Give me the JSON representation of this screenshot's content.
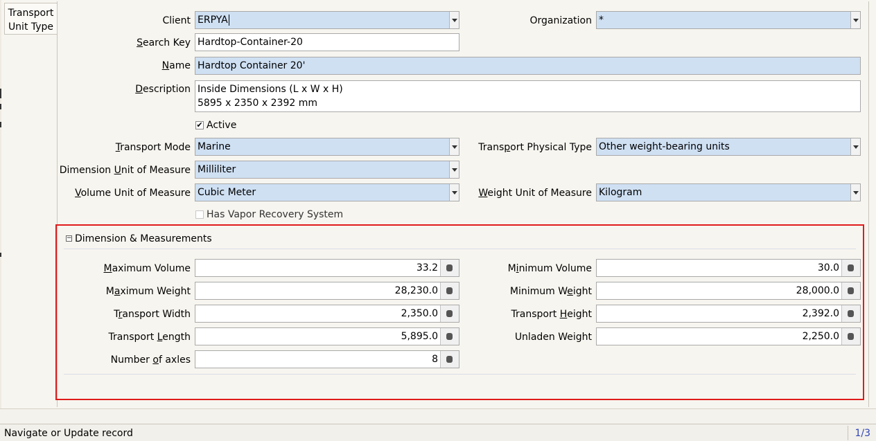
{
  "tab": {
    "label_line1": "Transport",
    "label_line2": "Unit Type"
  },
  "form": {
    "client": {
      "label_pre": "Client",
      "value": "ERPYA"
    },
    "organization": {
      "label": "Organization",
      "value": "*"
    },
    "search_key": {
      "label_u": "S",
      "label_rest": "earch Key",
      "value": "Hardtop-Container-20"
    },
    "name": {
      "label_u": "N",
      "label_rest": "ame",
      "value": "Hardtop Container 20'"
    },
    "description": {
      "label_u": "D",
      "label_rest": "escription",
      "line1": "Inside Dimensions (L x W x H)",
      "line2": "5895 x 2350 x 2392 mm"
    },
    "active": {
      "label": "Active",
      "checked": true,
      "mark": "✔"
    },
    "transport_mode": {
      "label_u": "T",
      "label_rest": "ransport Mode",
      "value": "Marine"
    },
    "transport_physical_type": {
      "label_pre": "Trans",
      "label_u": "p",
      "label_rest": "ort Physical Type",
      "value": "Other weight-bearing units"
    },
    "dimension_uom": {
      "label_pre": "Dimension ",
      "label_u": "U",
      "label_rest": "nit of Measure",
      "value": "Milliliter"
    },
    "volume_uom": {
      "label_u": "V",
      "label_rest": "olume Unit of Measure",
      "value": "Cubic Meter"
    },
    "weight_uom": {
      "label_u": "W",
      "label_rest": "eight Unit of Measure",
      "value": "Kilogram"
    },
    "vapor_recovery": {
      "label": "Has Vapor Recovery System",
      "checked": false
    }
  },
  "section": {
    "toggle": "−",
    "title": "Dimension & Measurements",
    "max_volume": {
      "label_u": "M",
      "label_rest": "aximum Volume",
      "value": "33.2"
    },
    "min_volume": {
      "label_pre": "M",
      "label_u": "i",
      "label_rest": "nimum Volume",
      "value": "30.0"
    },
    "max_weight": {
      "label_pre": "M",
      "label_u": "a",
      "label_rest": "ximum Weight",
      "value": "28,230.0"
    },
    "min_weight": {
      "label_pre": "Minimum W",
      "label_u": "e",
      "label_rest": "ight",
      "value": "28,000.0"
    },
    "transport_width": {
      "label_pre": "T",
      "label_u": "r",
      "label_rest": "ansport Width",
      "value": "2,350.0"
    },
    "transport_height": {
      "label_pre": "Transport ",
      "label_u": "H",
      "label_rest": "eight",
      "value": "2,392.0"
    },
    "transport_length": {
      "label_pre": "Transport ",
      "label_u": "L",
      "label_rest": "ength",
      "value": "5,895.0"
    },
    "unladen_weight": {
      "label": "Unladen Weight",
      "value": "2,250.0"
    },
    "number_of_axles": {
      "label_pre": "Number ",
      "label_u": "o",
      "label_rest": "f axles",
      "value": "8"
    }
  },
  "status": {
    "message": "Navigate or Update record",
    "record": "1/3"
  },
  "icons": {
    "combo_arrow": "chevron-down-icon",
    "calculator": "calculator-icon",
    "section_toggle": "collapse-icon"
  }
}
